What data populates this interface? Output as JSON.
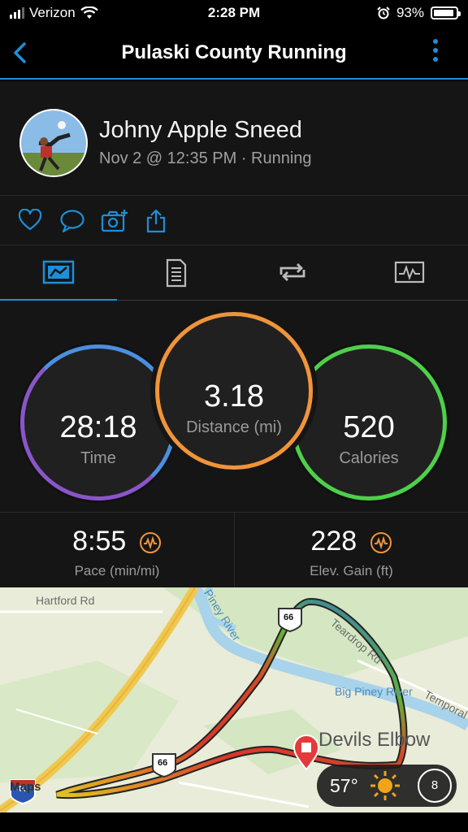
{
  "status_bar": {
    "carrier": "Verizon",
    "time": "2:28 PM",
    "battery": "93%",
    "battery_level": 0.93
  },
  "header": {
    "title": "Pulaski County Running",
    "back_icon": "chevron-left-icon",
    "menu_icon": "more-vertical-icon"
  },
  "profile": {
    "name": "Johny Apple Sneed",
    "meta": "Nov 2 @ 12:35 PM · Running"
  },
  "actions": [
    "like-icon",
    "comment-icon",
    "add-photo-icon",
    "share-icon"
  ],
  "tabs": [
    {
      "icon": "stats-icon",
      "active": true
    },
    {
      "icon": "details-icon",
      "active": false
    },
    {
      "icon": "laps-icon",
      "active": false
    },
    {
      "icon": "charts-icon",
      "active": false
    }
  ],
  "stats": {
    "time": {
      "value": "28:18",
      "label": "Time",
      "color_top": "#4a8fe0",
      "color_bottom": "#8a55c9"
    },
    "distance": {
      "value": "3.18",
      "label": "Distance (mi)",
      "color": "#f0943a"
    },
    "calories": {
      "value": "520",
      "label": "Calories",
      "color": "#4ed04a"
    }
  },
  "secondary": {
    "pace": {
      "value": "8:55",
      "label": "Pace (min/mi)"
    },
    "elevation": {
      "value": "228",
      "label": "Elev. Gain (ft)"
    },
    "accent": "#f0943a"
  },
  "map": {
    "labels": {
      "hartford": "Hartford Rd",
      "piney_river": "Piney River",
      "big_piney": "Big Piney River",
      "teardrop_rd": "Teardrop Rd",
      "temporal": "Temporal",
      "devils_elbow": "Devils Elbow",
      "route": "66",
      "interstate": "44",
      "maps_logo": "Maps"
    },
    "weather": {
      "temp": "57°",
      "wind": "8",
      "icon": "sun-icon"
    }
  }
}
